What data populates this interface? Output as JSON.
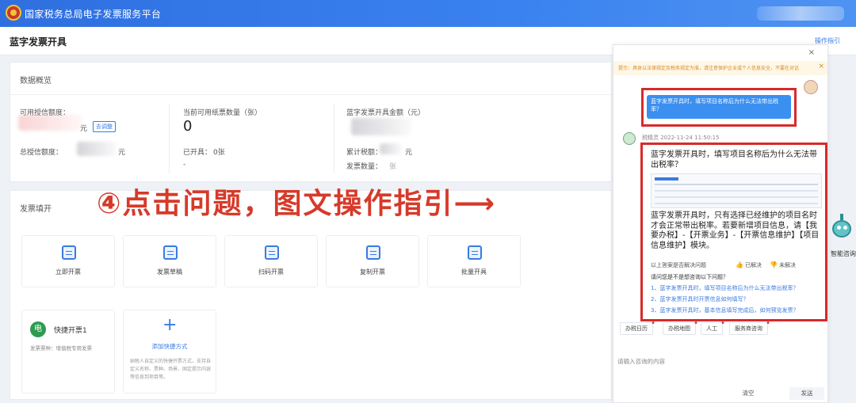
{
  "header": {
    "site_title": "国家税务总局电子发票服务平台"
  },
  "page": {
    "title": "蓝字发票开具",
    "guide_link": "操作指引"
  },
  "overview": {
    "title": "数据概览",
    "available_credit_label": "可用授信额度：",
    "available_credit_unit": "元",
    "query_button": "去调整",
    "total_credit_label": "总授信额度：",
    "total_credit_unit": "元",
    "paper_count_label": "当前可用纸票数量（张）",
    "paper_count_value": "0",
    "issued_label": "已开具：",
    "issued_value": "0张",
    "issued_sub": "-",
    "amount_label": "蓝字发票开具金额（元）",
    "tax_label": "累计税额：",
    "tax_unit": "元",
    "invoice_count_label": "发票数量：",
    "invoice_count_value": "张"
  },
  "issue": {
    "title": "发票填开",
    "tiles": [
      {
        "label": "立即开票",
        "icon": "invoice-icon"
      },
      {
        "label": "发票草稿",
        "icon": "draft-icon"
      },
      {
        "label": "扫码开票",
        "icon": "qr-code-icon"
      },
      {
        "label": "复制开票",
        "icon": "copy-icon"
      },
      {
        "label": "批量开具",
        "icon": "batch-icon"
      }
    ],
    "quick": {
      "badge": "电",
      "name": "快捷开票1",
      "sub": "发票票种：增值税专用发票"
    },
    "add": {
      "plus": "+",
      "label": "添加快捷方式",
      "desc": "纳税人自定义的快捷开票方式，支持自定义名称、票种、场景、固定提示内容等信息到项目等。"
    }
  },
  "annotation": "④点击问题，图文操作指引⟶",
  "chat": {
    "close": "×",
    "notice": "提示：具体以法律规定及税务规定为准，请注意保护企业或个人信息安全，不要在对话",
    "notice_close": "×",
    "user_question": "蓝字发票开具时，填写项目名称后为什么无法带出税率？",
    "bot_meta": "税精灵  2022-11-24 11:50:15",
    "answer_question": "蓝字发票开具时，填写项目名称后为什么无法带出税率？",
    "answer_body": "蓝字发票开具时，只有选择已经维护的项目名时才会正常带出税率。若要新增项目信息，请【我要办税】-【开票业务】-【开票信息维护】【项目信息维护】模块。",
    "resolved_question": "以上答案是否解决问题",
    "resolved_yes": "已解决",
    "resolved_no": "未解决",
    "related_title": "请问您是不是想咨询以下问题？",
    "related": [
      "1、蓝字发票开具时，填写项目名称后为什么无法带出税率？",
      "2、蓝字发票开具时开票信息如何填写？",
      "3、蓝字发票开具时，基本信息填写完成后，如何预览发票？"
    ],
    "chips": [
      "办税日历",
      "办税地图",
      "人工",
      "服务商咨询"
    ],
    "input_placeholder": "请输入咨询的内容",
    "clear": "清空",
    "send": "发送"
  },
  "robot_label": "智能咨询"
}
